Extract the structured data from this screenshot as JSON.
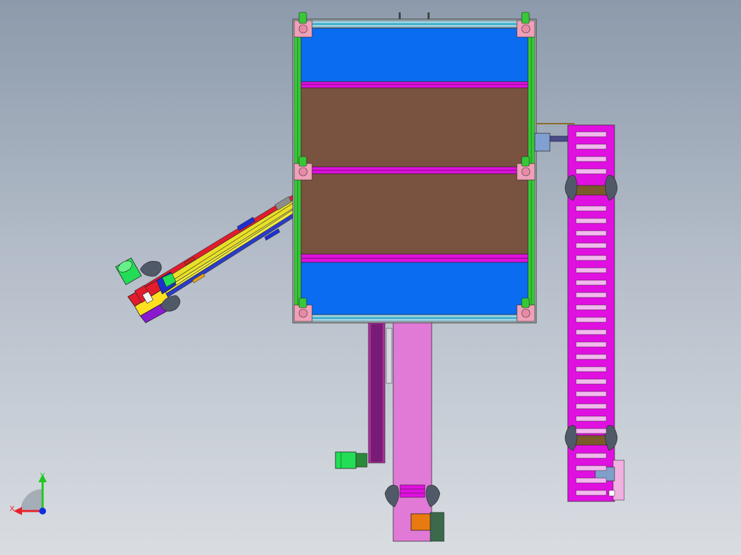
{
  "viewport": {
    "view": "top-view",
    "background_top": "#8c9aab",
    "background_bottom": "#d9dde2"
  },
  "colors": {
    "blue_panel": "#0a6cf0",
    "brown_panel": "#7a5240",
    "frame_green": "#37c837",
    "frame_cyan": "#2aa7c9",
    "magenta": "#e010e0",
    "pink_conveyor": "#e07ad6",
    "motor_green": "#22dd55",
    "motor_orange": "#e87a10",
    "gray_mount": "#505968",
    "corner_pink": "#f0a0b8"
  },
  "triad": {
    "x_label": "X",
    "y_label": "Y",
    "x_color": "#e8202a",
    "y_color": "#1ec81e",
    "z_color": "#1030e0"
  },
  "components": [
    "main-frame",
    "upper-blue-panel",
    "brown-panel-upper",
    "brown-panel-lower",
    "lower-blue-panel",
    "right-magenta-conveyor",
    "bottom-pink-conveyor",
    "inclined-feeder",
    "green-motor",
    "orange-motor",
    "side-gearbox"
  ]
}
